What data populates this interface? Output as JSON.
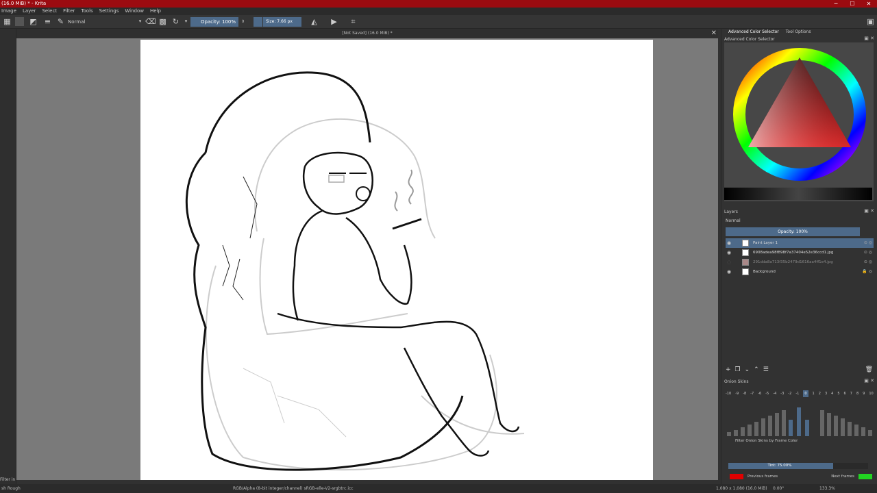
{
  "window": {
    "title": "(16.0 MiB) * - Krita",
    "minimize": "─",
    "maximize": "☐",
    "close": "✕"
  },
  "menu": [
    "Image",
    "Layer",
    "Select",
    "Filter",
    "Tools",
    "Settings",
    "Window",
    "Help"
  ],
  "toolbar": {
    "blend_mode": "Normal",
    "opacity": "Opacity: 100%",
    "size": "Size: 7.66 px"
  },
  "document": {
    "tab_title": "[Not Saved]  (16.0 MiB) *",
    "close": "✕"
  },
  "dock": {
    "tabs": [
      "Advanced Color Selector",
      "Tool Options"
    ],
    "color_selector_title": "Advanced Color Selector",
    "layers": {
      "title": "Layers",
      "blend_mode": "Normal",
      "opacity": "Opacity:  100%",
      "items": [
        {
          "name": "Paint Layer 1",
          "selected": true,
          "visible": true
        },
        {
          "name": "6908adea98f898f7a37404e52e36ccd1.jpg",
          "selected": false,
          "visible": true
        },
        {
          "name": "291dda8a713f35b2479d1616aa4ff1e4.jpg",
          "selected": false,
          "visible": false
        },
        {
          "name": "Background",
          "selected": false,
          "visible": true,
          "locked": true
        }
      ]
    },
    "onion": {
      "title": "Onion Skins",
      "frames": [
        "-10",
        "-9",
        "-8",
        "-7",
        "-6",
        "-5",
        "-4",
        "-3",
        "-2",
        "-1",
        "0",
        "1",
        "2",
        "3",
        "4",
        "5",
        "6",
        "7",
        "8",
        "9",
        "10"
      ],
      "current_frame": "0",
      "filter_label": "Filter Onion Skins by Frame Color",
      "tint": "Tint: 75.00%",
      "tint_value": 0.75,
      "previous_frames": "Previous frames",
      "next_frames": "Next frames",
      "previous_color": "#e00000",
      "next_color": "#21d421"
    }
  },
  "status": {
    "filter_in": "Filter in",
    "brush": "sh Rough",
    "color_space": "RGB/Alpha (8-bit integer/channel)  sRGB-elle-V2-srgbtrc.icc",
    "image_size": "1,080 x 1,080 (16.0 MiB)",
    "rotation": "0.00°",
    "zoom": "133.3%"
  },
  "colors": {
    "accent": "#4d6a8a",
    "titlebar": "#9b0b10"
  }
}
